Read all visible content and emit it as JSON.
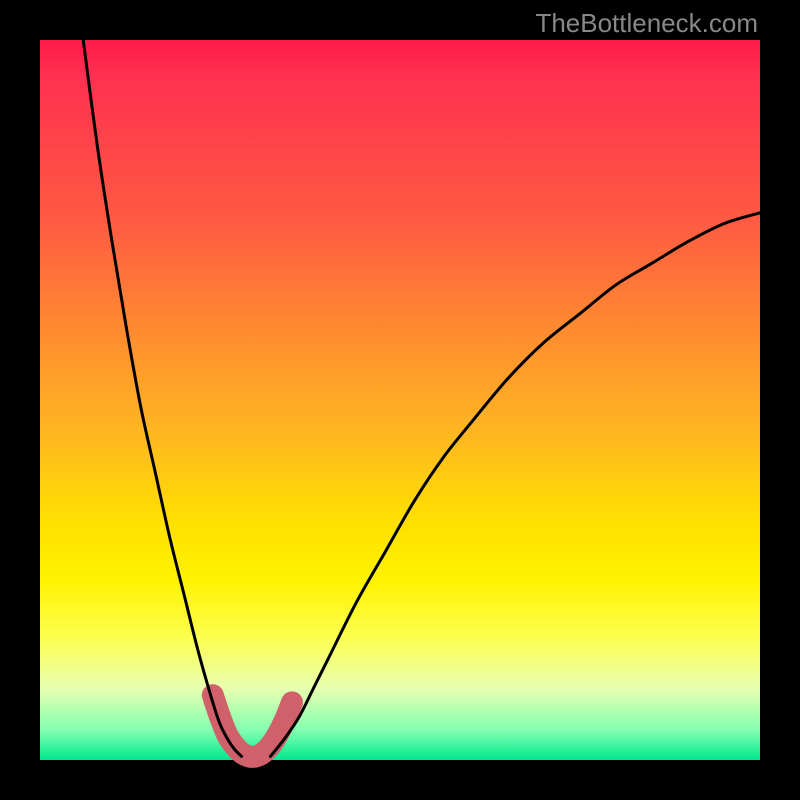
{
  "attribution": "TheBottleneck.com",
  "chart_data": {
    "type": "line",
    "title": "",
    "xlabel": "",
    "ylabel": "",
    "xlim": [
      0,
      100
    ],
    "ylim": [
      0,
      100
    ],
    "series": [
      {
        "name": "left-curve",
        "x": [
          6,
          8,
          10,
          12,
          14,
          16,
          18,
          20,
          22,
          24,
          25,
          26,
          27,
          28
        ],
        "y": [
          100,
          85,
          72,
          60,
          49,
          40,
          31,
          23,
          15,
          8,
          5,
          3,
          1.5,
          0.5
        ]
      },
      {
        "name": "right-curve",
        "x": [
          32,
          34,
          36,
          38,
          40,
          44,
          48,
          52,
          56,
          60,
          65,
          70,
          75,
          80,
          85,
          90,
          95,
          100
        ],
        "y": [
          0.5,
          3,
          6,
          10,
          14,
          22,
          29,
          36,
          42,
          47,
          53,
          58,
          62,
          66,
          69,
          72,
          74.5,
          76
        ]
      },
      {
        "name": "highlight-band",
        "x": [
          24,
          25,
          26,
          27,
          28,
          29,
          30,
          31,
          32,
          33,
          34,
          35
        ],
        "y": [
          9,
          6,
          3.5,
          2,
          1,
          0.5,
          0.5,
          1,
          2,
          3.5,
          5.5,
          8
        ]
      }
    ],
    "colors": {
      "curve": "#000000",
      "highlight": "#d0606a"
    }
  }
}
